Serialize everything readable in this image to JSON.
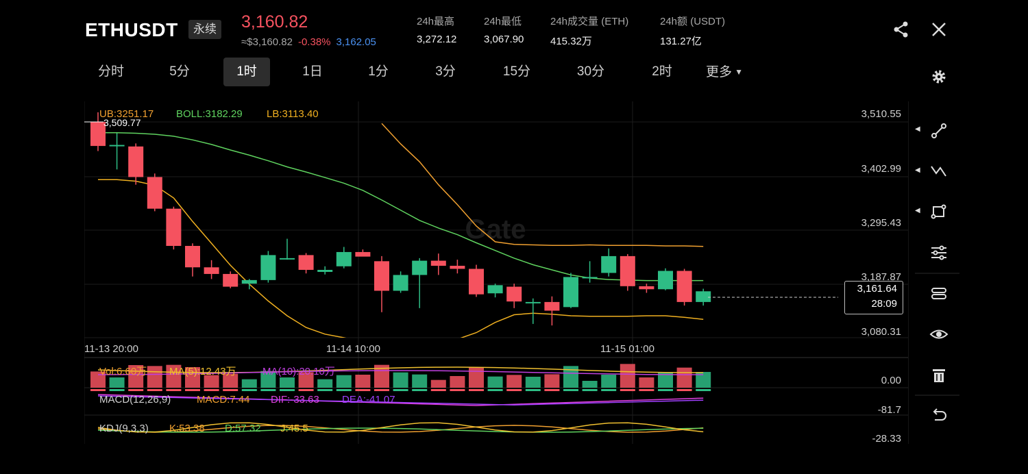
{
  "header": {
    "symbol": "ETHUSDT",
    "contract_type": "永续",
    "last_price": "3,160.82",
    "usd_price": "≈$3,160.82",
    "change_pct": "-0.38%",
    "mark_price": "3,162.05",
    "stats": [
      {
        "label": "24h最高",
        "value": "3,272.12"
      },
      {
        "label": "24h最低",
        "value": "3,067.90"
      },
      {
        "label": "24h成交量 (ETH)",
        "value": "415.32万"
      },
      {
        "label": "24h额 (USDT)",
        "value": "131.27亿"
      }
    ],
    "share_icon": "share-icon",
    "close_icon": "close-icon"
  },
  "timeframes": {
    "items": [
      "分时",
      "5分",
      "1时",
      "1日",
      "1分",
      "3分",
      "15分",
      "30分",
      "2时",
      "更多"
    ],
    "active": "1时",
    "more_icon": "caret-down-icon",
    "settings_icon": "gear-icon"
  },
  "chart": {
    "watermark": "Gate",
    "boll": {
      "ub": "UB:3251.17",
      "boll": "BOLL:3182.29",
      "lb": "LB:3113.40"
    },
    "high_marker": "3,509.77",
    "price_axis": [
      "3,510.55",
      "3,402.99",
      "3,295.43",
      "3,187.87",
      "3,080.31"
    ],
    "time_axis": [
      "11-13 20:00",
      "11-14 10:00",
      "11-15 01:00"
    ],
    "current_price": "3,161.64",
    "countdown": "28:09",
    "volume": {
      "vol": "Vol:6.60万",
      "ma5": "MA(5):12.43万",
      "ma10": "MA(10):20.10万",
      "axis": "0.00"
    },
    "macd": {
      "name": "MACD(12,26,9)",
      "macd": "MACD:7.44",
      "dif": "DIF:-33.63",
      "dea": "DEA:-41.07",
      "axis": "-81.7"
    },
    "kdj": {
      "name": "KDJ(9,3,3)",
      "k": "K:53.38",
      "d": "D:57.32",
      "j": "J:45.5",
      "axis": "-28.33"
    },
    "colors": {
      "up": "#2ebd85",
      "down": "#f5525f",
      "ub": "#f0a030",
      "mid": "#5fd35f",
      "lb": "#f0b020",
      "macd_dif": "#e040e0",
      "macd_dea": "#a040ff"
    }
  },
  "chart_data": {
    "type": "candlestick",
    "candles": [
      {
        "o": 3493,
        "h": 3512,
        "l": 3436,
        "c": 3446
      },
      {
        "o": 3448,
        "h": 3471,
        "l": 3400,
        "c": 3448
      },
      {
        "o": 3445,
        "h": 3451,
        "l": 3370,
        "c": 3385
      },
      {
        "o": 3385,
        "h": 3392,
        "l": 3318,
        "c": 3323
      },
      {
        "o": 3323,
        "h": 3327,
        "l": 3243,
        "c": 3250
      },
      {
        "o": 3250,
        "h": 3255,
        "l": 3190,
        "c": 3208
      },
      {
        "o": 3208,
        "h": 3222,
        "l": 3185,
        "c": 3195
      },
      {
        "o": 3195,
        "h": 3200,
        "l": 3167,
        "c": 3170
      },
      {
        "o": 3176,
        "h": 3185,
        "l": 3165,
        "c": 3183
      },
      {
        "o": 3183,
        "h": 3240,
        "l": 3178,
        "c": 3232
      },
      {
        "o": 3226,
        "h": 3264,
        "l": 3223,
        "c": 3226
      },
      {
        "o": 3232,
        "h": 3236,
        "l": 3196,
        "c": 3203
      },
      {
        "o": 3199,
        "h": 3210,
        "l": 3194,
        "c": 3203
      },
      {
        "o": 3210,
        "h": 3248,
        "l": 3206,
        "c": 3238
      },
      {
        "o": 3238,
        "h": 3243,
        "l": 3231,
        "c": 3229
      },
      {
        "o": 3220,
        "h": 3230,
        "l": 3120,
        "c": 3162
      },
      {
        "o": 3162,
        "h": 3200,
        "l": 3158,
        "c": 3193
      },
      {
        "o": 3193,
        "h": 3226,
        "l": 3128,
        "c": 3221
      },
      {
        "o": 3221,
        "h": 3235,
        "l": 3193,
        "c": 3211
      },
      {
        "o": 3211,
        "h": 3223,
        "l": 3196,
        "c": 3205
      },
      {
        "o": 3205,
        "h": 3213,
        "l": 3150,
        "c": 3155
      },
      {
        "o": 3157,
        "h": 3176,
        "l": 3149,
        "c": 3173
      },
      {
        "o": 3170,
        "h": 3176,
        "l": 3128,
        "c": 3141
      },
      {
        "o": 3140,
        "h": 3147,
        "l": 3097,
        "c": 3140
      },
      {
        "o": 3140,
        "h": 3151,
        "l": 3094,
        "c": 3123
      },
      {
        "o": 3130,
        "h": 3197,
        "l": 3128,
        "c": 3189
      },
      {
        "o": 3189,
        "h": 3220,
        "l": 3178,
        "c": 3189
      },
      {
        "o": 3197,
        "h": 3245,
        "l": 3190,
        "c": 3230
      },
      {
        "o": 3230,
        "h": 3234,
        "l": 3162,
        "c": 3171
      },
      {
        "o": 3171,
        "h": 3176,
        "l": 3158,
        "c": 3165
      },
      {
        "o": 3165,
        "h": 3206,
        "l": 3163,
        "c": 3201
      },
      {
        "o": 3201,
        "h": 3205,
        "l": 3133,
        "c": 3140
      },
      {
        "o": 3140,
        "h": 3166,
        "l": 3133,
        "c": 3161
      }
    ],
    "boll_mid": [
      3472,
      3472,
      3471,
      3469,
      3465,
      3458,
      3449,
      3438,
      3428,
      3417,
      3405,
      3395,
      3384,
      3373,
      3359,
      3340,
      3320,
      3300,
      3285,
      3272,
      3256,
      3241,
      3226,
      3213,
      3203,
      3193,
      3187,
      3184,
      3183,
      3182,
      3182,
      3182,
      3182
    ],
    "boll_ub": [
      null,
      null,
      null,
      null,
      null,
      null,
      null,
      null,
      null,
      null,
      null,
      null,
      null,
      null,
      null,
      3490,
      3450,
      3415,
      3370,
      3331,
      3289,
      3258,
      3253,
      3252,
      3251,
      3251,
      3252,
      3251,
      3251,
      3251,
      3250,
      3250,
      3249
    ],
    "boll_lb": [
      3380,
      3380,
      3377,
      3369,
      3344,
      3298,
      3255,
      3212,
      3175,
      3142,
      3113,
      3090,
      3077,
      3070,
      3062,
      3054,
      3050,
      3050,
      3058,
      3067,
      3080,
      3100,
      3115,
      3118,
      3116,
      3113,
      3112,
      3112,
      3112,
      3113,
      3113,
      3110,
      3106
    ],
    "y_range": [
      3070,
      3520
    ]
  },
  "tools": [
    {
      "name": "trend-line-icon",
      "expandable": true
    },
    {
      "name": "wave-line-icon",
      "expandable": true
    },
    {
      "name": "shape-icon",
      "expandable": true
    },
    {
      "name": "sliders-icon",
      "expandable": false
    },
    {
      "name": "layers-icon",
      "expandable": false
    },
    {
      "name": "eye-icon",
      "expandable": false
    },
    {
      "name": "trash-icon",
      "expandable": false
    },
    {
      "name": "undo-icon",
      "expandable": false
    }
  ]
}
